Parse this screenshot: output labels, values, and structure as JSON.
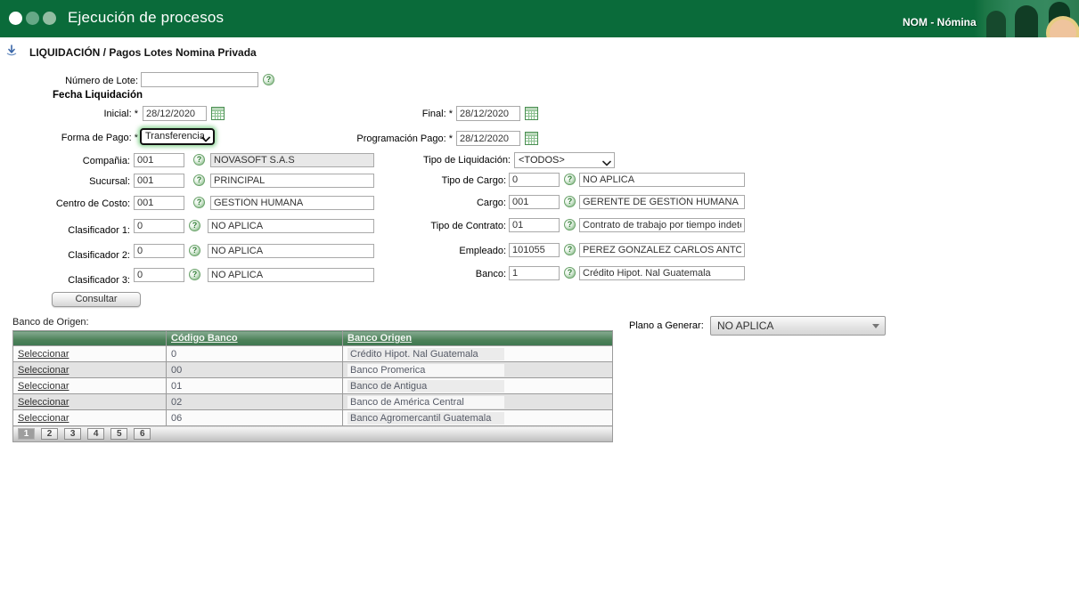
{
  "header": {
    "title": "Ejecución de procesos",
    "module": "NOM - Nómina"
  },
  "breadcrumb": {
    "title": "LIQUIDACIÓN / Pagos Lotes Nomina Privada"
  },
  "form": {
    "numero_lote": {
      "label": "Número de Lote:",
      "value": ""
    },
    "fecha_heading": "Fecha Liquidación",
    "inicial": {
      "label": "Inicial: *",
      "value": "28/12/2020"
    },
    "final": {
      "label": "Final: *",
      "value": "28/12/2020"
    },
    "forma_pago": {
      "label": "Forma de Pago: *",
      "value": "Transferencia"
    },
    "programacion_pago": {
      "label": "Programación Pago: *",
      "value": "28/12/2020"
    },
    "compania": {
      "label": "Compañia:",
      "code": "001",
      "name": "NOVASOFT S.A.S"
    },
    "tipo_liquidacion": {
      "label": "Tipo de Liquidación:",
      "value": "<TODOS>"
    },
    "sucursal": {
      "label": "Sucursal:",
      "code": "001",
      "name": "PRINCIPAL"
    },
    "tipo_cargo": {
      "label": "Tipo de Cargo:",
      "code": "0",
      "name": "NO APLICA"
    },
    "centro_costo": {
      "label": "Centro de Costo:",
      "code": "001",
      "name": "GESTIÓN HUMANA"
    },
    "cargo": {
      "label": "Cargo:",
      "code": "001",
      "name": "GERENTE DE GESTIÓN HUMANA"
    },
    "clasificador1": {
      "label": "Clasificador 1:",
      "code": "0",
      "name": "NO APLICA"
    },
    "tipo_contrato": {
      "label": "Tipo de Contrato:",
      "code": "01",
      "name": "Contrato de trabajo por tiempo indetermina"
    },
    "clasificador2": {
      "label": "Clasificador 2:",
      "code": "0",
      "name": "NO APLICA"
    },
    "empleado": {
      "label": "Empleado:",
      "code": "101055",
      "name": "PEREZ GONZALEZ CARLOS ANTONIO"
    },
    "clasificador3": {
      "label": "Clasificador 3:",
      "code": "0",
      "name": "NO APLICA"
    },
    "banco": {
      "label": "Banco:",
      "code": "1",
      "name": "Crédito Hipot. Nal Guatemala"
    },
    "consultar_label": "Consultar"
  },
  "table": {
    "caption": "Banco de Origen:",
    "select_label": "Seleccionar",
    "columns": [
      "Código Banco",
      "Banco Origen"
    ],
    "rows": [
      {
        "codigo": "0",
        "banco": "Crédito Hipot. Nal Guatemala"
      },
      {
        "codigo": "00",
        "banco": "Banco Promerica"
      },
      {
        "codigo": "01",
        "banco": "Banco de Antigua"
      },
      {
        "codigo": "02",
        "banco": "Banco de América Central"
      },
      {
        "codigo": "06",
        "banco": "Banco Agromercantil Guatemala"
      }
    ],
    "pages": [
      "1",
      "2",
      "3",
      "4",
      "5",
      "6"
    ],
    "current_page": "1"
  },
  "plano": {
    "label": "Plano a Generar:",
    "value": "NO APLICA"
  },
  "colors": {
    "topbar_green": "#0a6b3a",
    "table_header_green": "#3e7750",
    "help_icon_green": "#6aaa6a",
    "focus_glow_green": "#82d28c"
  }
}
